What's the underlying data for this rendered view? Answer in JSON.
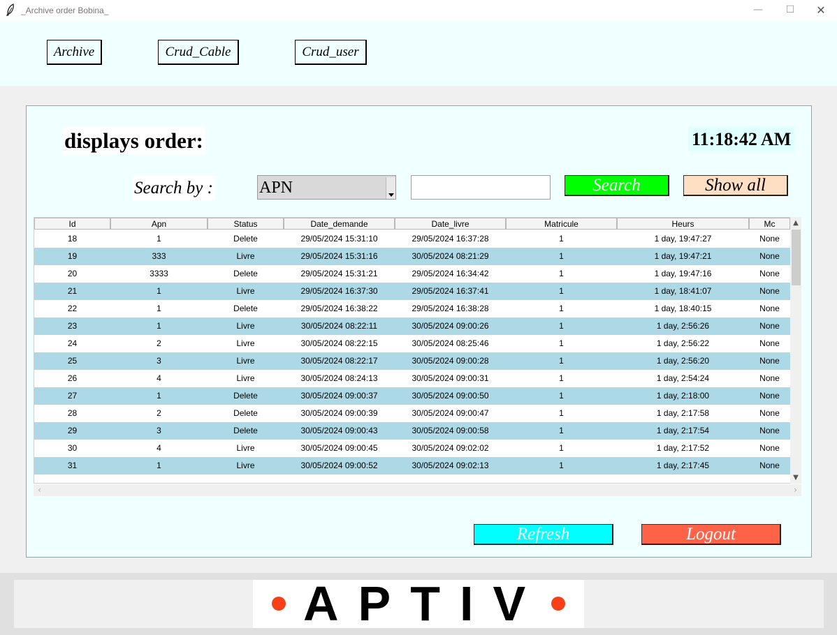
{
  "window": {
    "title": "_Archive order Bobina_",
    "controls": {
      "minimize": "—",
      "maximize": "☐",
      "close": "✕"
    }
  },
  "nav": {
    "archive": "Archive",
    "crud_cable": "Crud_Cable",
    "crud_user": "Crud_user"
  },
  "main": {
    "heading": "displays order:",
    "clock": "11:18:42 AM",
    "search_label": "Search by :",
    "search_by_selected": "APN",
    "search_input_value": "",
    "search_button": "Search",
    "show_all_button": "Show all",
    "refresh_button": "Refresh",
    "logout_button": "Logout"
  },
  "table": {
    "columns": [
      "Id",
      "Apn",
      "Status",
      "Date_demande",
      "Date_livre",
      "Matricule",
      "Heurs",
      "Mc"
    ],
    "rows": [
      [
        "18",
        "1",
        "Delete",
        "29/05/2024 15:31:10",
        "29/05/2024 16:37:28",
        "1",
        "1 day, 19:47:27",
        "None"
      ],
      [
        "19",
        "333",
        "Livre",
        "29/05/2024 15:31:16",
        "30/05/2024 08:21:29",
        "1",
        "1 day, 19:47:21",
        "None"
      ],
      [
        "20",
        "3333",
        "Delete",
        "29/05/2024 15:31:21",
        "29/05/2024 16:34:42",
        "1",
        "1 day, 19:47:16",
        "None"
      ],
      [
        "21",
        "1",
        "Livre",
        "29/05/2024 16:37:30",
        "29/05/2024 16:37:41",
        "1",
        "1 day, 18:41:07",
        "None"
      ],
      [
        "22",
        "1",
        "Delete",
        "29/05/2024 16:38:22",
        "29/05/2024 16:38:28",
        "1",
        "1 day, 18:40:15",
        "None"
      ],
      [
        "23",
        "1",
        "Livre",
        "30/05/2024 08:22:11",
        "30/05/2024 09:00:26",
        "1",
        "1 day, 2:56:26",
        "None"
      ],
      [
        "24",
        "2",
        "Livre",
        "30/05/2024 08:22:15",
        "30/05/2024 08:25:46",
        "1",
        "1 day, 2:56:22",
        "None"
      ],
      [
        "25",
        "3",
        "Livre",
        "30/05/2024 08:22:17",
        "30/05/2024 09:00:28",
        "1",
        "1 day, 2:56:20",
        "None"
      ],
      [
        "26",
        "4",
        "Livre",
        "30/05/2024 08:24:13",
        "30/05/2024 09:00:31",
        "1",
        "1 day, 2:54:24",
        "None"
      ],
      [
        "27",
        "1",
        "Delete",
        "30/05/2024 09:00:37",
        "30/05/2024 09:00:50",
        "1",
        "1 day, 2:18:00",
        "None"
      ],
      [
        "28",
        "2",
        "Delete",
        "30/05/2024 09:00:39",
        "30/05/2024 09:00:47",
        "1",
        "1 day, 2:17:58",
        "None"
      ],
      [
        "29",
        "3",
        "Delete",
        "30/05/2024 09:00:43",
        "30/05/2024 09:00:58",
        "1",
        "1 day, 2:17:54",
        "None"
      ],
      [
        "30",
        "4",
        "Livre",
        "30/05/2024 09:00:45",
        "30/05/2024 09:02:02",
        "1",
        "1 day, 2:17:52",
        "None"
      ],
      [
        "31",
        "1",
        "Livre",
        "30/05/2024 09:00:52",
        "30/05/2024 09:02:13",
        "1",
        "1 day, 2:17:45",
        "None"
      ]
    ]
  },
  "footer": {
    "logo_text": "APTIV"
  },
  "colors": {
    "search_button": "#00ff00",
    "show_all_button": "#ffdfc4",
    "refresh_button": "#00ffff",
    "logout_button": "#ff6347",
    "row_alt": "#add8e6",
    "panel_bg": "#f0ffff",
    "logo_dot": "#f84018"
  },
  "icons": {
    "app": "feather-icon",
    "combo": "dropdown-arrow-icon",
    "scroll_up": "scroll-up-arrow-icon",
    "scroll_down": "scroll-down-arrow-icon",
    "scroll_left": "scroll-left-arrow-icon",
    "scroll_right": "scroll-right-arrow-icon"
  }
}
